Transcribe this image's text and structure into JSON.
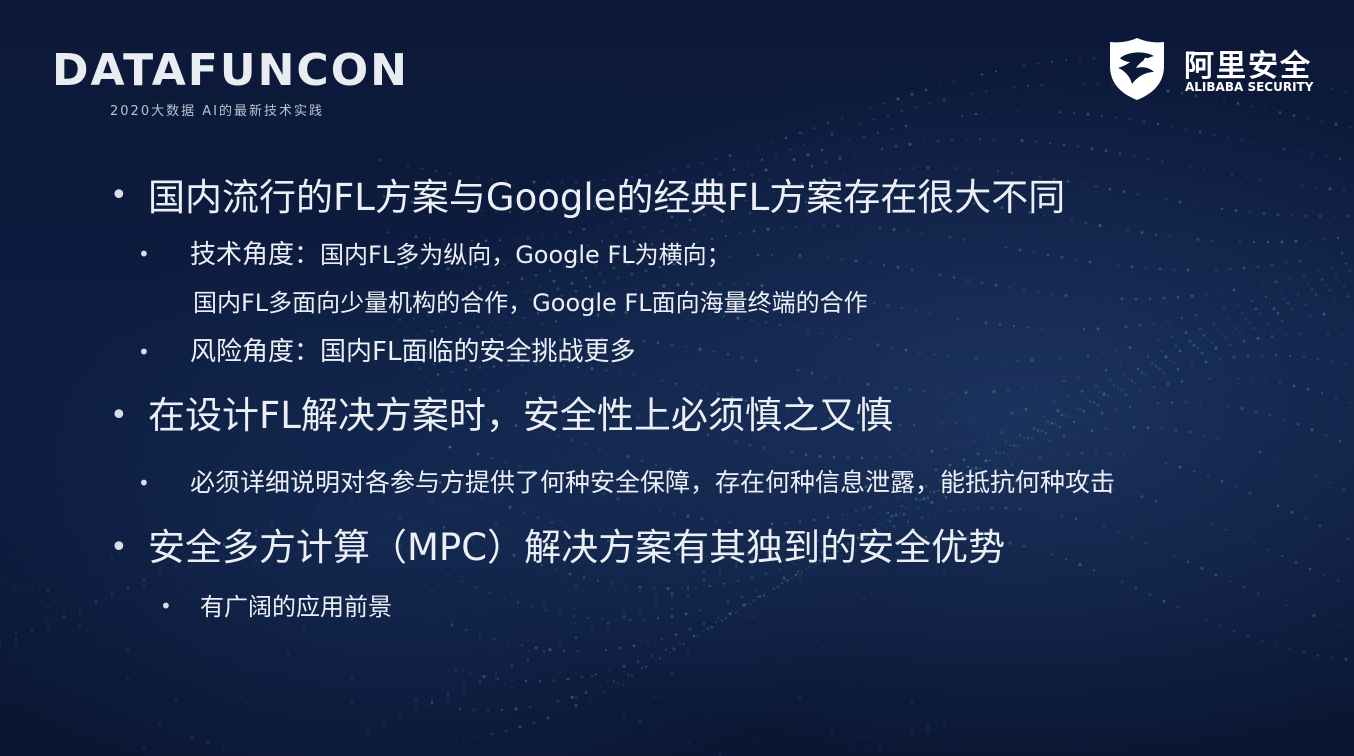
{
  "brand": {
    "title": "DATAFUNCON",
    "subtitle": "2020大数据 AI的最新技术实践"
  },
  "security_logo": {
    "name": "阿里安全",
    "english": "ALIBABA SECURITY",
    "icon": "shield-icon"
  },
  "bullets": [
    {
      "level": 1,
      "text": "国内流行的FL方案与Google的经典FL方案存在很大不同"
    },
    {
      "level": 2,
      "lead": "技术角度：",
      "text": "国内FL多为纵向，Google FL为横向；"
    },
    {
      "level": 2,
      "continuation": true,
      "text": "国内FL多面向少量机构的合作，Google FL面向海量终端的合作"
    },
    {
      "level": 2,
      "text": "风险角度：国内FL面临的安全挑战更多"
    },
    {
      "level": 1,
      "text": "在设计FL解决方案时，安全性上必须慎之又慎"
    },
    {
      "level": 2,
      "text": "必须详细说明对各参与方提供了何种安全保障，存在何种信息泄露，能抵抗何种攻击"
    },
    {
      "level": 1,
      "text": "安全多方计算（MPC）解决方案有其独到的安全优势"
    },
    {
      "level": 2,
      "text": "有广阔的应用前景"
    }
  ],
  "colors": {
    "background": "#0c1838",
    "text": "#eceff5",
    "dots": "#3fa7a0"
  }
}
